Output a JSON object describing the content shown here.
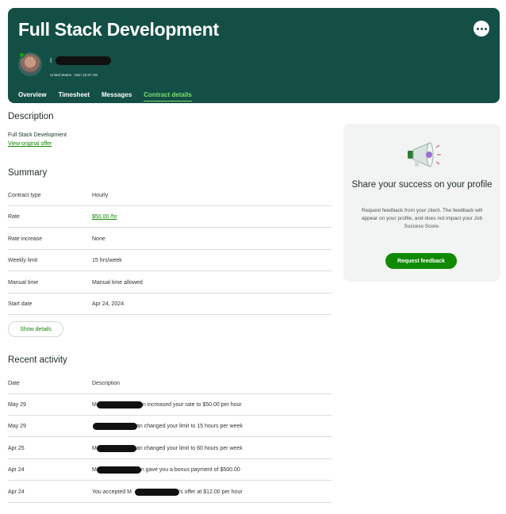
{
  "header": {
    "title": "Full Stack Development",
    "client_name": "I",
    "client_meta": "United States · Mon 10:37 AM",
    "tabs": [
      "Overview",
      "Timesheet",
      "Messages",
      "Contract details"
    ],
    "active_tab": "Contract details"
  },
  "description": {
    "heading": "Description",
    "text": "Full Stack Development",
    "link": "View original offer"
  },
  "summary": {
    "heading": "Summary",
    "rows": [
      {
        "label": "Contract type",
        "value": "Hourly"
      },
      {
        "label": "Rate",
        "value": "$50.00 /hr"
      },
      {
        "label": "Rate increase",
        "value": "None"
      },
      {
        "label": "Weekly limit",
        "value": "15 hrs/week"
      },
      {
        "label": "Manual time",
        "value": "Manual time allowed"
      },
      {
        "label": "Start date",
        "value": "Apr 24, 2024"
      }
    ],
    "show_details": "Show details"
  },
  "activity": {
    "heading": "Recent activity",
    "col_date": "Date",
    "col_desc": "Description",
    "rows": [
      {
        "date": "May 29",
        "prefix": "M",
        "desc": "n increased your rate to $50.00 per hour"
      },
      {
        "date": "May 29",
        "prefix": "",
        "desc": "an changed your limit to 15 hours per week"
      },
      {
        "date": "Apr 25",
        "prefix": "M",
        "desc": "an changed your limit to 60 hours per week"
      },
      {
        "date": "Apr 24",
        "prefix": "M",
        "desc": "n gave you a bonus payment of $500.00"
      },
      {
        "date": "Apr 24",
        "prefix": "You accepted M",
        "desc": "n's offer at $12.00 per hour"
      }
    ]
  },
  "feedback_card": {
    "title": "Share your success on your profile",
    "body": "Request feedback from your client. The feedback will appear on your profile, and does not impact your Job Success Score.",
    "button": "Request feedback"
  },
  "colors": {
    "header_bg": "#134f45",
    "accent_green": "#108a00",
    "active_tab": "#7ee06a",
    "card_bg": "#f2f4f3"
  },
  "icons": [
    "more-icon",
    "megaphone-icon",
    "avatar"
  ]
}
